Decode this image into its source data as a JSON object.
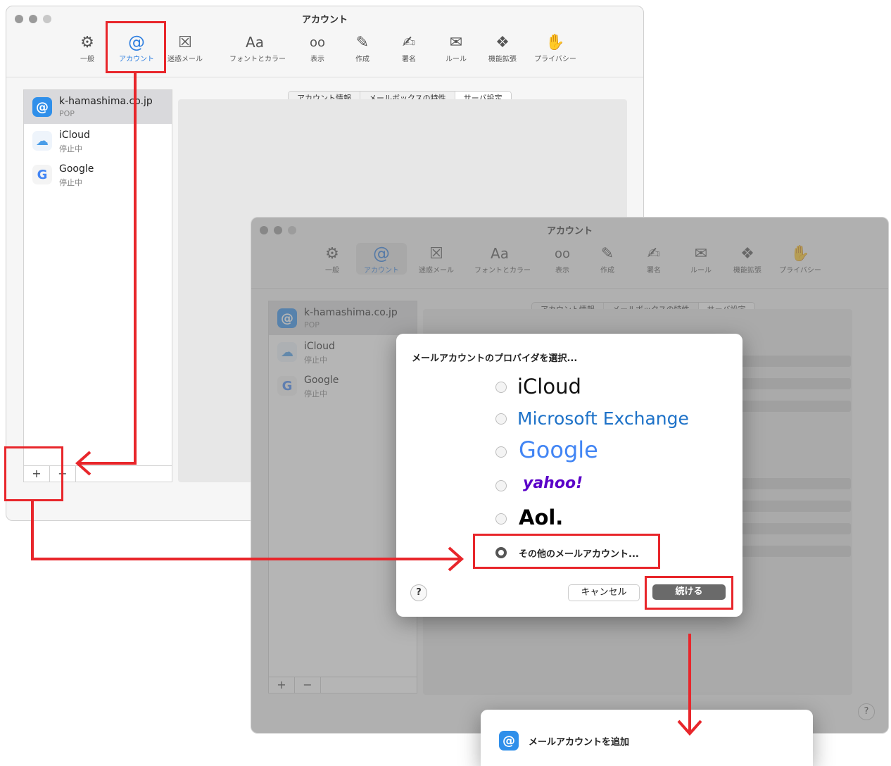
{
  "window_title": "アカウント",
  "toolbar": [
    {
      "label": "一般",
      "icon": "gear-icon",
      "glyph": "⚙"
    },
    {
      "label": "アカウント",
      "icon": "at-sign-icon",
      "glyph": "@"
    },
    {
      "label": "迷惑メール",
      "icon": "junk-mail-icon",
      "glyph": "☒"
    },
    {
      "label": "フォントとカラー",
      "icon": "font-icon",
      "glyph": "Aa"
    },
    {
      "label": "表示",
      "icon": "glasses-icon",
      "glyph": "oo"
    },
    {
      "label": "作成",
      "icon": "compose-icon",
      "glyph": "✎"
    },
    {
      "label": "署名",
      "icon": "signature-icon",
      "glyph": "✍"
    },
    {
      "label": "ルール",
      "icon": "rules-icon",
      "glyph": "✉"
    },
    {
      "label": "機能拡張",
      "icon": "puzzle-icon",
      "glyph": "❖"
    },
    {
      "label": "プライバシー",
      "icon": "hand-icon",
      "glyph": "✋"
    }
  ],
  "accounts": [
    {
      "name": "k-hamashima.co.jp",
      "type": "POP",
      "icon": "mail-at-icon"
    },
    {
      "name": "iCloud",
      "type": "停止中",
      "icon": "icloud-icon"
    },
    {
      "name": "Google",
      "type": "停止中",
      "icon": "google-icon"
    }
  ],
  "segments": [
    "アカウント情報",
    "メールボックスの特性",
    "サーバ設定"
  ],
  "plus_label": "+",
  "minus_label": "−",
  "help_label": "?",
  "dialog": {
    "title": "メールアカウントのプロバイダを選択...",
    "providers": [
      "iCloud",
      "Microsoft Exchange",
      "Google",
      "yahoo!",
      "Aol."
    ],
    "other": "その他のメールアカウント...",
    "cancel": "キャンセル",
    "continue": "続ける"
  },
  "next_dialog_title": "メールアカウントを追加",
  "colors": {
    "accent": "#2f7fe0",
    "annotation_red": "#e8262b"
  }
}
